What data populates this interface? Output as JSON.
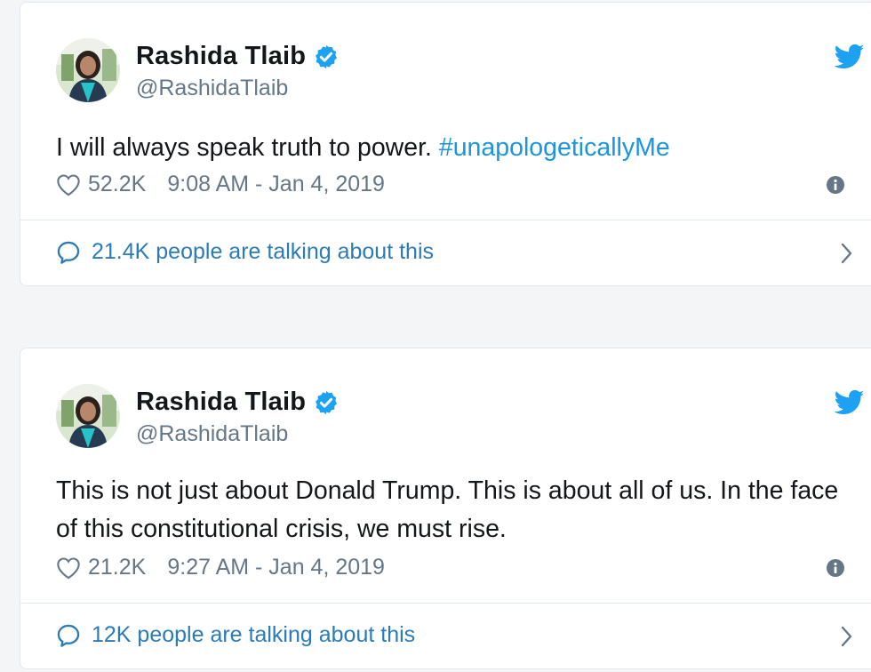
{
  "colors": {
    "link": "#1b95e0",
    "talk": "#2b7bb9",
    "secondary": "#657786",
    "text": "#14171a",
    "verified": "#1da1f2",
    "background": "#f4f5f6"
  },
  "tweets": [
    {
      "name": "Rashida Tlaib",
      "handle": "@RashidaTlaib",
      "text_plain": "I will always speak truth to power. ",
      "hashtag": "#unapologeticallyMe",
      "likes": "52.2K",
      "timestamp": "9:08 AM - Jan 4, 2019",
      "talking": "21.4K people are talking about this",
      "icons": [
        "avatar",
        "verified-badge-icon",
        "twitter-bird-icon",
        "heart-icon",
        "info-icon",
        "speech-bubble-icon",
        "chevron-right-icon"
      ]
    },
    {
      "name": "Rashida Tlaib",
      "handle": "@RashidaTlaib",
      "text_plain": "This is not just about Donald Trump. This is about all of us. In the face of this constitutional crisis, we must rise.",
      "likes": "21.2K",
      "timestamp": "9:27 AM - Jan 4, 2019",
      "talking": "12K people are talking about this",
      "icons": [
        "avatar",
        "verified-badge-icon",
        "twitter-bird-icon",
        "heart-icon",
        "info-icon",
        "speech-bubble-icon",
        "chevron-right-icon"
      ]
    }
  ]
}
